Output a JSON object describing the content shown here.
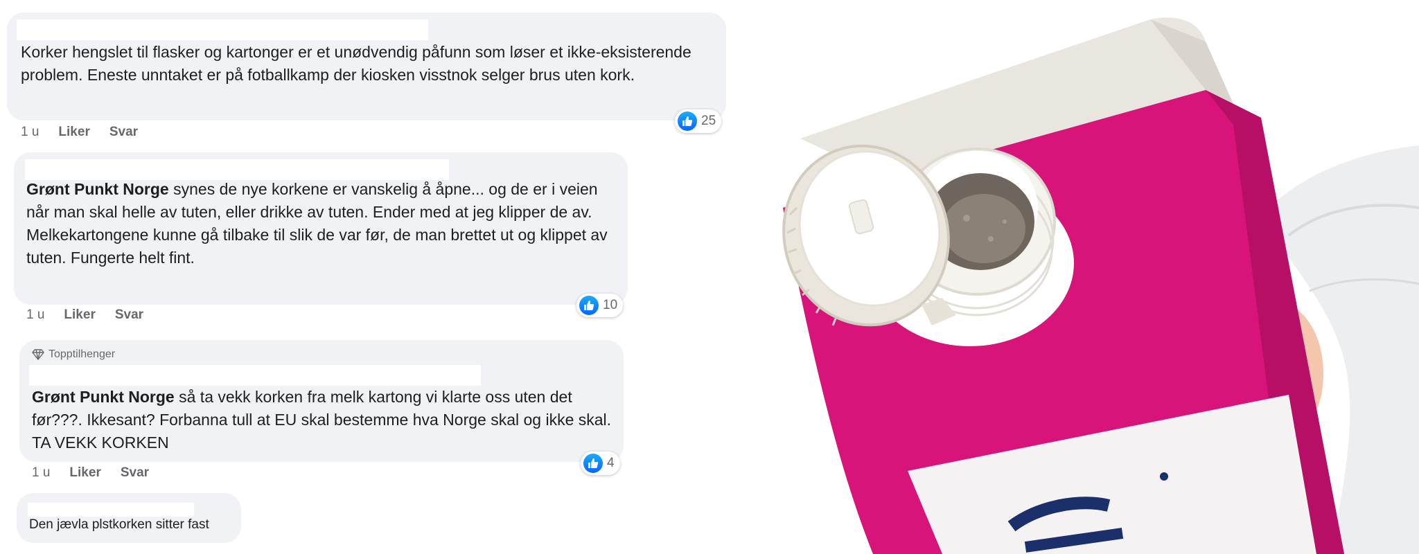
{
  "comments": [
    {
      "author": "",
      "text": "Korker hengslet til flasker og kartonger er et unødvendig påfunn som løser et ikke-eksisterende problem. Eneste unntaket er på fotballkamp der kiosken visstnok selger brus uten kork.",
      "time": "1 u",
      "like_label": "Liker",
      "reply_label": "Svar",
      "reaction_count": "25"
    },
    {
      "author": "Grønt Punkt Norge",
      "text": " synes de nye korkene er vanskelig å åpne... og de er i veien når man skal helle av tuten, eller drikke av tuten. Ender med at jeg klipper de av.",
      "text2": "Melkekartongene kunne gå tilbake til slik de var før, de man brettet ut og klippet av tuten. Fungerte helt fint.",
      "time": "1 u",
      "like_label": "Liker",
      "reply_label": "Svar",
      "reaction_count": "10"
    },
    {
      "badge": "Topptilhenger",
      "author": "Grønt Punkt Norge",
      "text": " så ta vekk korken fra melk kartong vi klarte oss uten det før???. Ikkesant? Forbanna tull at EU skal bestemme hva Norge skal og ikke skal. TA VEKK KORKEN",
      "time": "1 u",
      "like_label": "Liker",
      "reply_label": "Svar",
      "reaction_count": "4"
    },
    {
      "text": "Den jævla plstkorken sitter fast"
    }
  ],
  "colors": {
    "bubble": "#f0f2f5",
    "like_blue": "#0866ff",
    "carton_pink": "#d8137a",
    "cap_white": "#f2efe9"
  },
  "icons": [
    "thumbs-up-icon",
    "diamond-icon"
  ]
}
